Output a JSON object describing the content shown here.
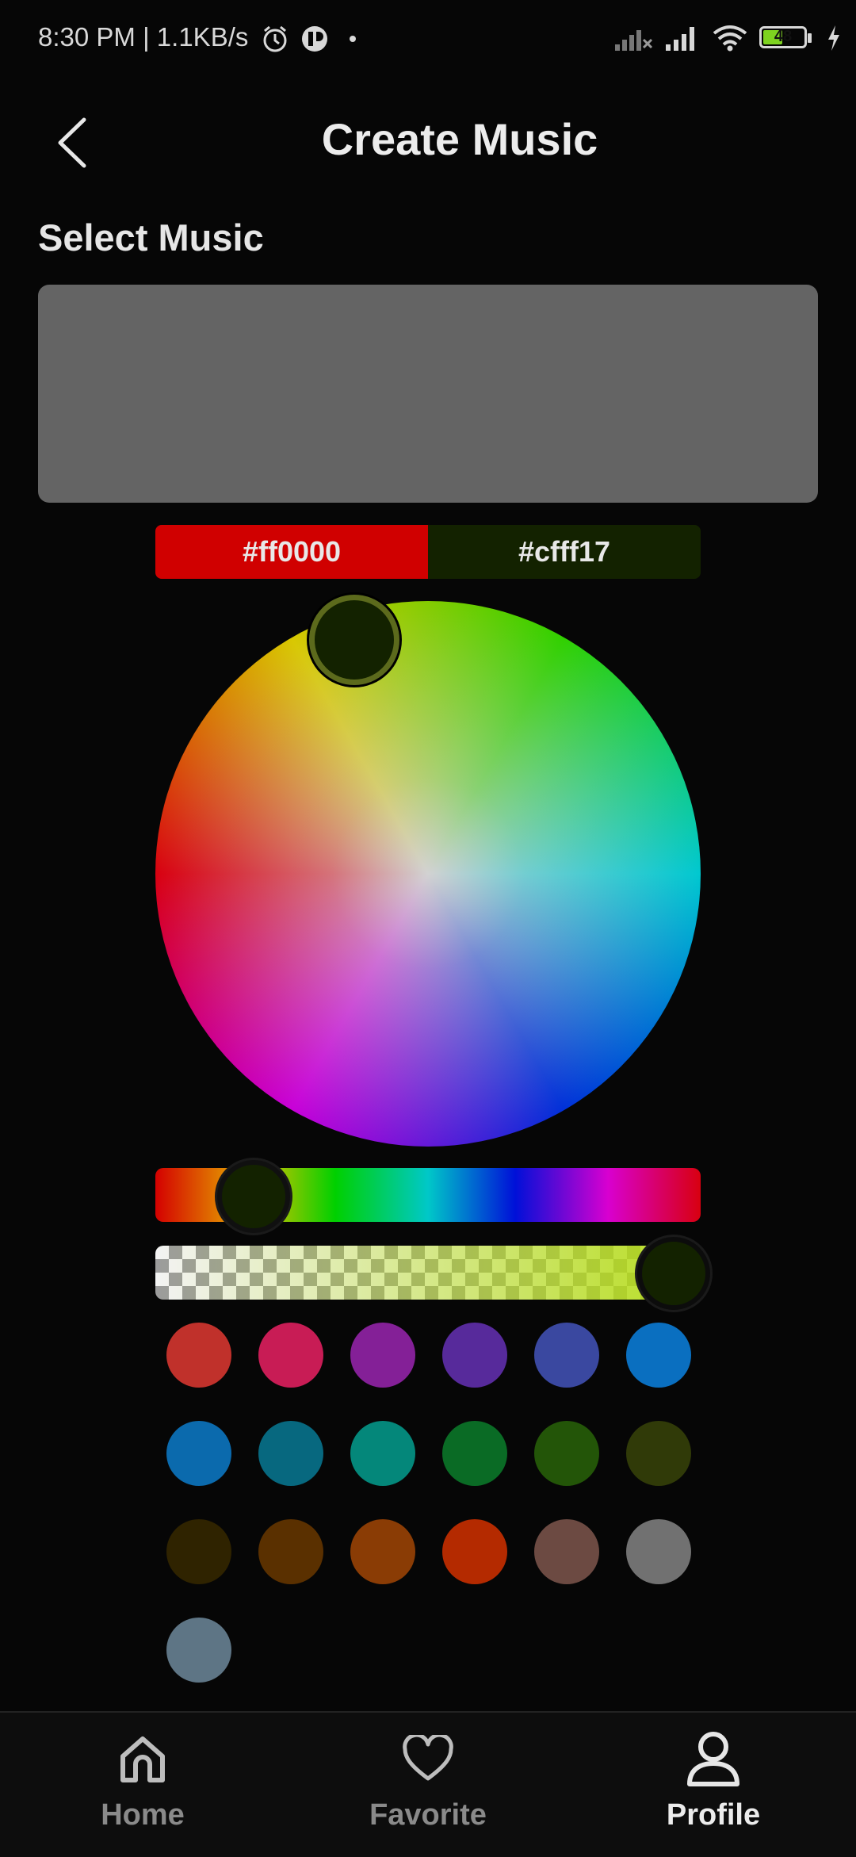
{
  "status_bar": {
    "time_speed": "8:30 PM | 1.1KB/s",
    "battery_level": "48",
    "icons": [
      "alarm-icon",
      "app-notification-icon",
      "dot-icon",
      "signal-off-icon",
      "signal-icon",
      "wifi-icon",
      "battery-icon",
      "charging-icon"
    ]
  },
  "header": {
    "title": "Create Music",
    "back_icon": "chevron-left-icon"
  },
  "select_music": {
    "label": "Select Music"
  },
  "color_picker": {
    "old_color": {
      "hex": "#ff0000",
      "swatch": "#d00000"
    },
    "new_color": {
      "hex": "#cfff17",
      "swatch": "#132200"
    },
    "hue_position": 0.18,
    "alpha_position": 0.95,
    "swatches": [
      "#c0312b",
      "#c81c55",
      "#842097",
      "#572a9b",
      "#3a48a0",
      "#0a6fc0",
      "#0b6aad",
      "#07687f",
      "#04877a",
      "#0a6b25",
      "#235508",
      "#303a08",
      "#2f2300",
      "#5a3000",
      "#8a3c05",
      "#b42a00",
      "#6c4a42",
      "#717171",
      "#5e7585"
    ]
  },
  "bottom_nav": {
    "items": [
      {
        "label": "Home",
        "icon": "home-icon",
        "active": false
      },
      {
        "label": "Favorite",
        "icon": "heart-icon",
        "active": false
      },
      {
        "label": "Profile",
        "icon": "person-icon",
        "active": true
      }
    ]
  }
}
